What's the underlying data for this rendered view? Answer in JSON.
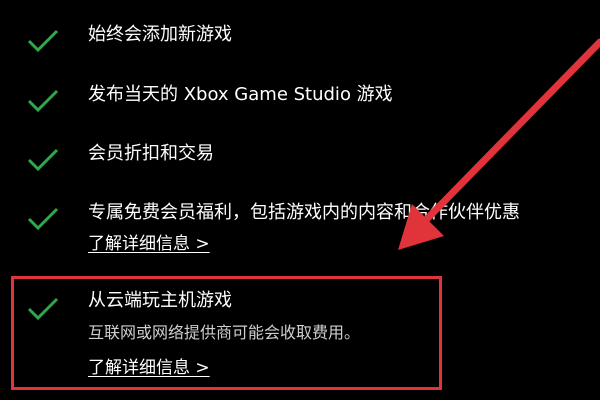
{
  "benefits": [
    {
      "title": "始终会添加新游戏"
    },
    {
      "title": "发布当天的 Xbox Game Studio 游戏"
    },
    {
      "title": "会员折扣和交易"
    },
    {
      "title": "专属免费会员福利，包括游戏内的内容和合作伙伴优惠",
      "link": "了解详细信息 >"
    },
    {
      "title": "从云端玩主机游戏",
      "description": "互联网或网络提供商可能会收取费用。",
      "link": "了解详细信息 >"
    }
  ],
  "colors": {
    "background": "#000000",
    "check": "#2fa84a",
    "annotation": "#e0333a"
  },
  "icons": {
    "check": "checkmark-icon",
    "annotation_arrow": "arrow-icon"
  }
}
